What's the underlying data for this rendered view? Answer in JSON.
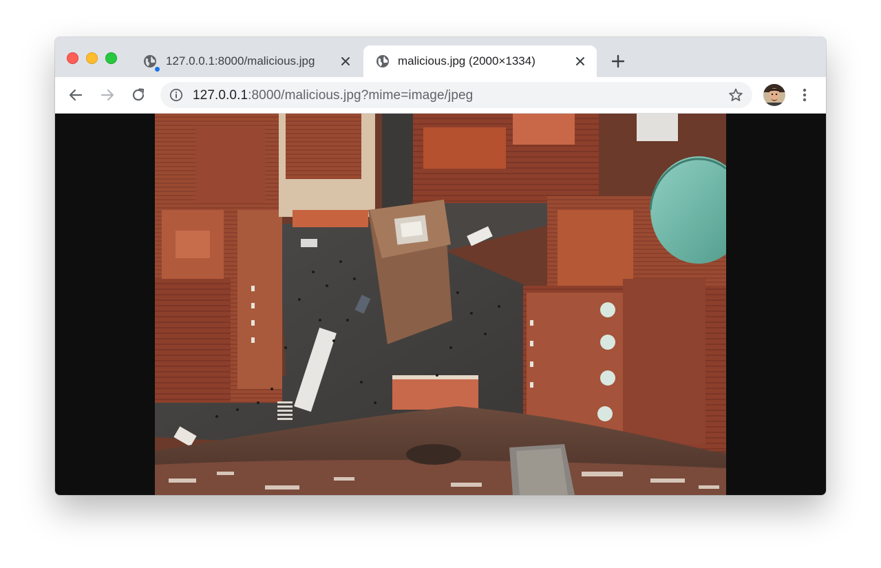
{
  "window": {
    "controls": [
      "close",
      "minimize",
      "maximize"
    ]
  },
  "tabs": [
    {
      "title": "127.0.0.1:8000/malicious.jpg",
      "active": false,
      "favicon": "globe-icon",
      "has_badge": true
    },
    {
      "title": "malicious.jpg (2000×1334)",
      "active": true,
      "favicon": "globe-icon"
    }
  ],
  "toolbar": {
    "url_host": "127.0.0.1",
    "url_rest": ":8000/malicious.jpg?mime=image/jpeg",
    "icons": [
      "back-icon",
      "forward-icon",
      "reload-icon",
      "info-icon",
      "star-icon",
      "avatar",
      "menu-icon"
    ]
  },
  "content": {
    "image": "aerial-city-photo"
  },
  "colors": {
    "tabstrip": "#dee1e6",
    "toolbar": "#ffffff",
    "omnibox": "#f1f3f4",
    "content_background": "#0e0e0e",
    "badge": "#1a73e8"
  }
}
